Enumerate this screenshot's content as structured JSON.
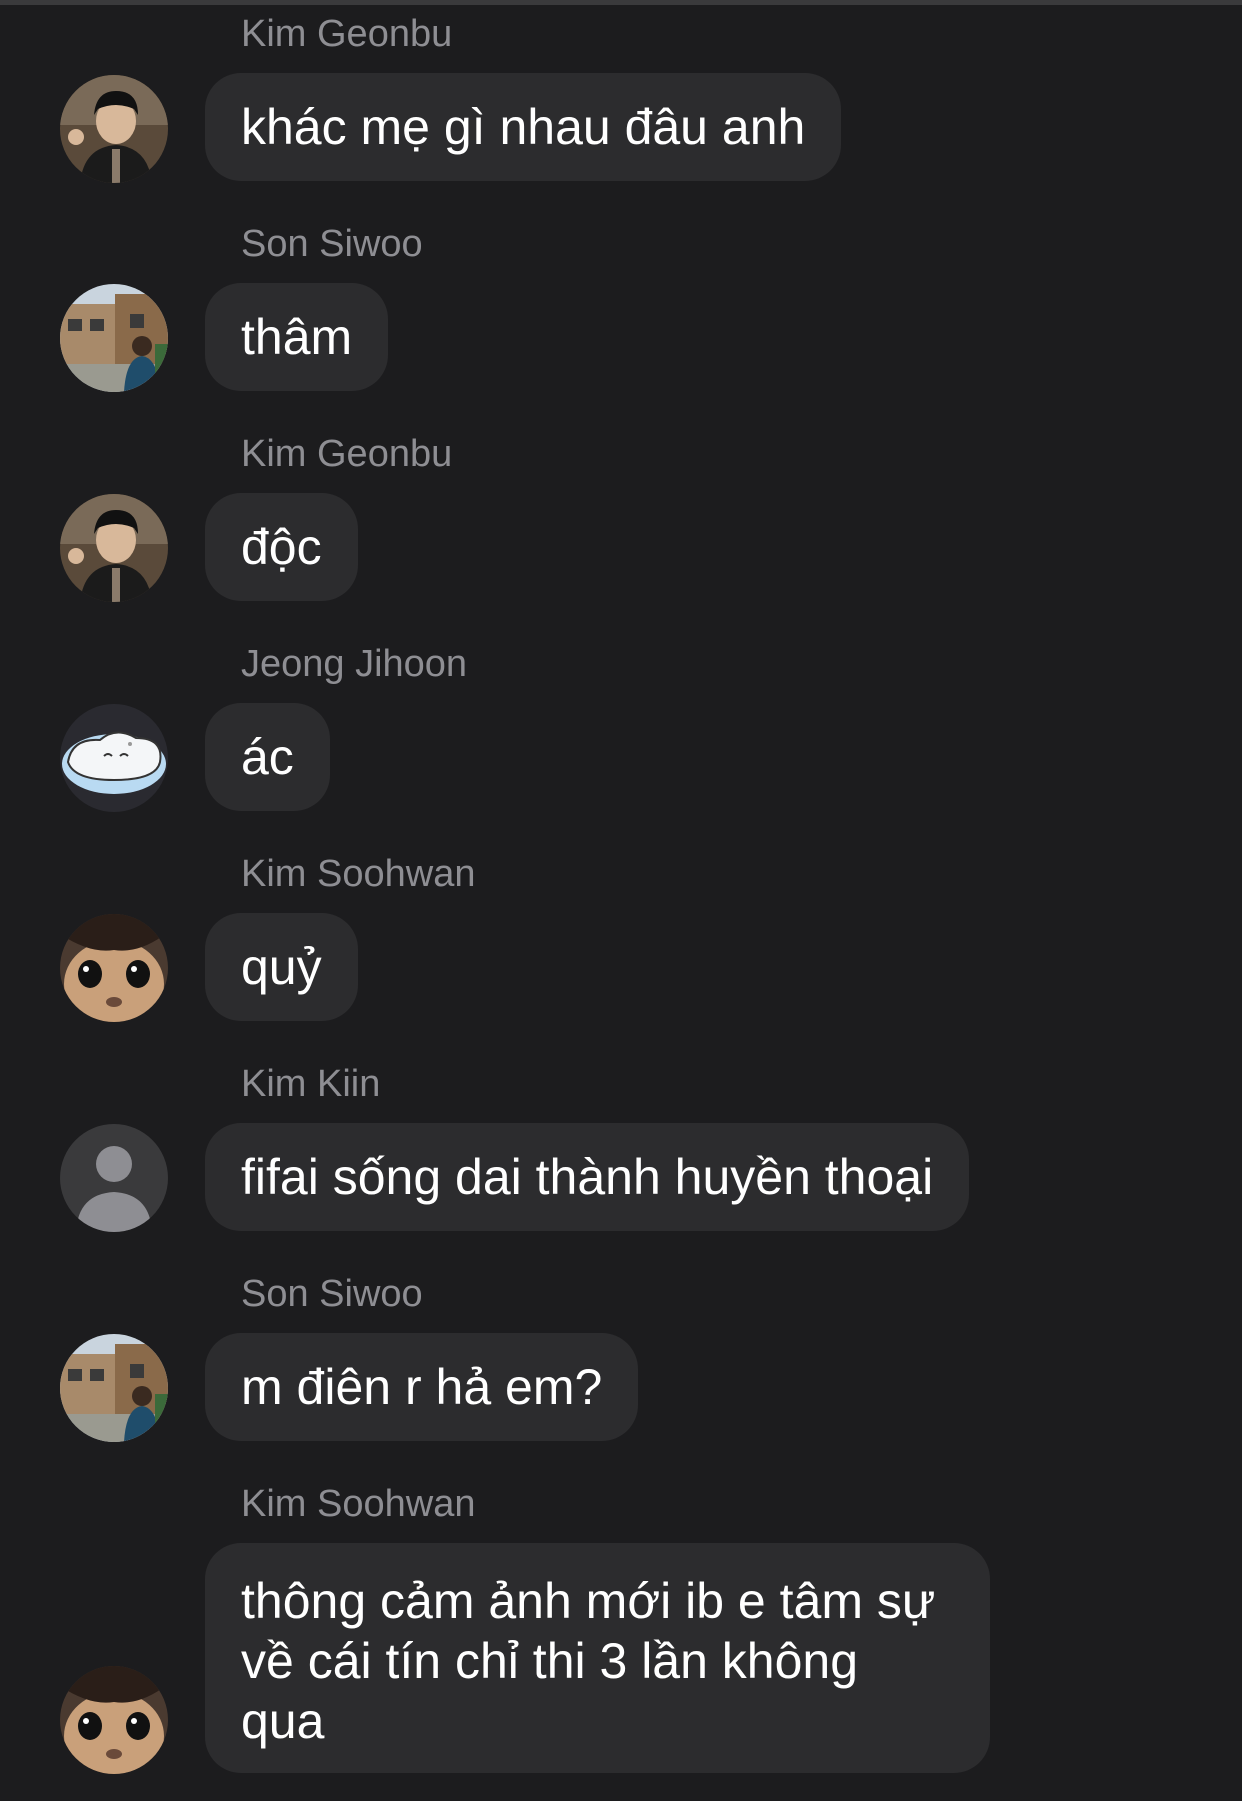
{
  "messages": [
    {
      "sender": "Kim Geonbu",
      "text": "khác mẹ gì nhau đâu anh",
      "avatar": "person-dark-jacket-photo"
    },
    {
      "sender": "Son Siwoo",
      "text": "thâm",
      "avatar": "person-street-photo"
    },
    {
      "sender": "Kim Geonbu",
      "text": "độc",
      "avatar": "person-dark-jacket-photo"
    },
    {
      "sender": "Jeong Jihoon",
      "text": "ác",
      "avatar": "cartoon-blob-icon"
    },
    {
      "sender": "Kim Soohwan",
      "text": "quỷ",
      "avatar": "cat-photo"
    },
    {
      "sender": "Kim Kiin",
      "text": "fifai sống dai thành huyền thoại",
      "avatar": "default-user-icon"
    },
    {
      "sender": "Son Siwoo",
      "text": "m điên r hả em?",
      "avatar": "person-street-photo"
    },
    {
      "sender": "Kim Soohwan",
      "text": "thông cảm ảnh mới ib e tâm sự về cái tín chỉ thi 3 lần không qua",
      "avatar": "cat-photo"
    }
  ],
  "colors": {
    "background": "#1c1c1e",
    "bubble": "#2c2c2e",
    "sender_name": "#8e8e93",
    "message_text": "#ffffff"
  }
}
